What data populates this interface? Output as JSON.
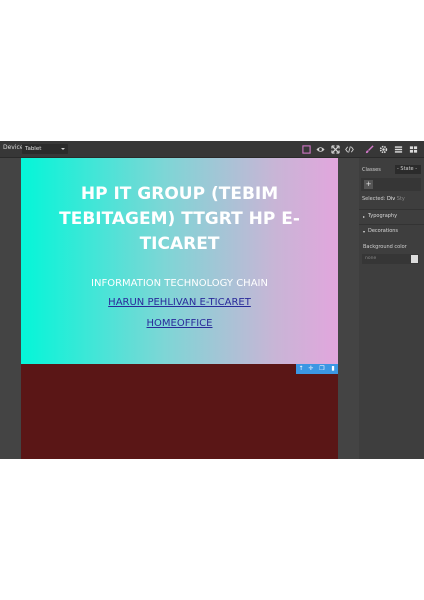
{
  "topbar": {
    "device_label": "Device",
    "device_value": "Tablet",
    "icons": [
      "square-outline-icon",
      "eye-icon",
      "fullscreen-icon",
      "code-icon",
      "paintbrush-icon",
      "gear-icon",
      "layers-icon",
      "blocks-icon"
    ]
  },
  "hero": {
    "title": "HP IT GROUP (TEBIM TEBITAGEM) TTGRT HP E-TICARET",
    "subtitle": "INFORMATION TECHNOLOGY CHAIN",
    "link1": "HARUN PEHLIVAN E-TICARET",
    "link2": "HOMEOFFICE"
  },
  "panel": {
    "classes_label": "Classes",
    "state_value": "- State -",
    "add_label": "+",
    "selected_label": "Selected:",
    "selected_value": "Div",
    "selected_hint": "Sty",
    "typography_label": "Typography",
    "decorations_label": "Decorations",
    "bg_color_label": "Background color",
    "bg_color_placeholder": "none"
  },
  "colors": {
    "accent": "#3b97e3",
    "gradient_start": "#04f6d8",
    "gradient_end": "#e2a6dd",
    "canvas_bg": "#5a1616",
    "active_icon": "#d278c9"
  }
}
